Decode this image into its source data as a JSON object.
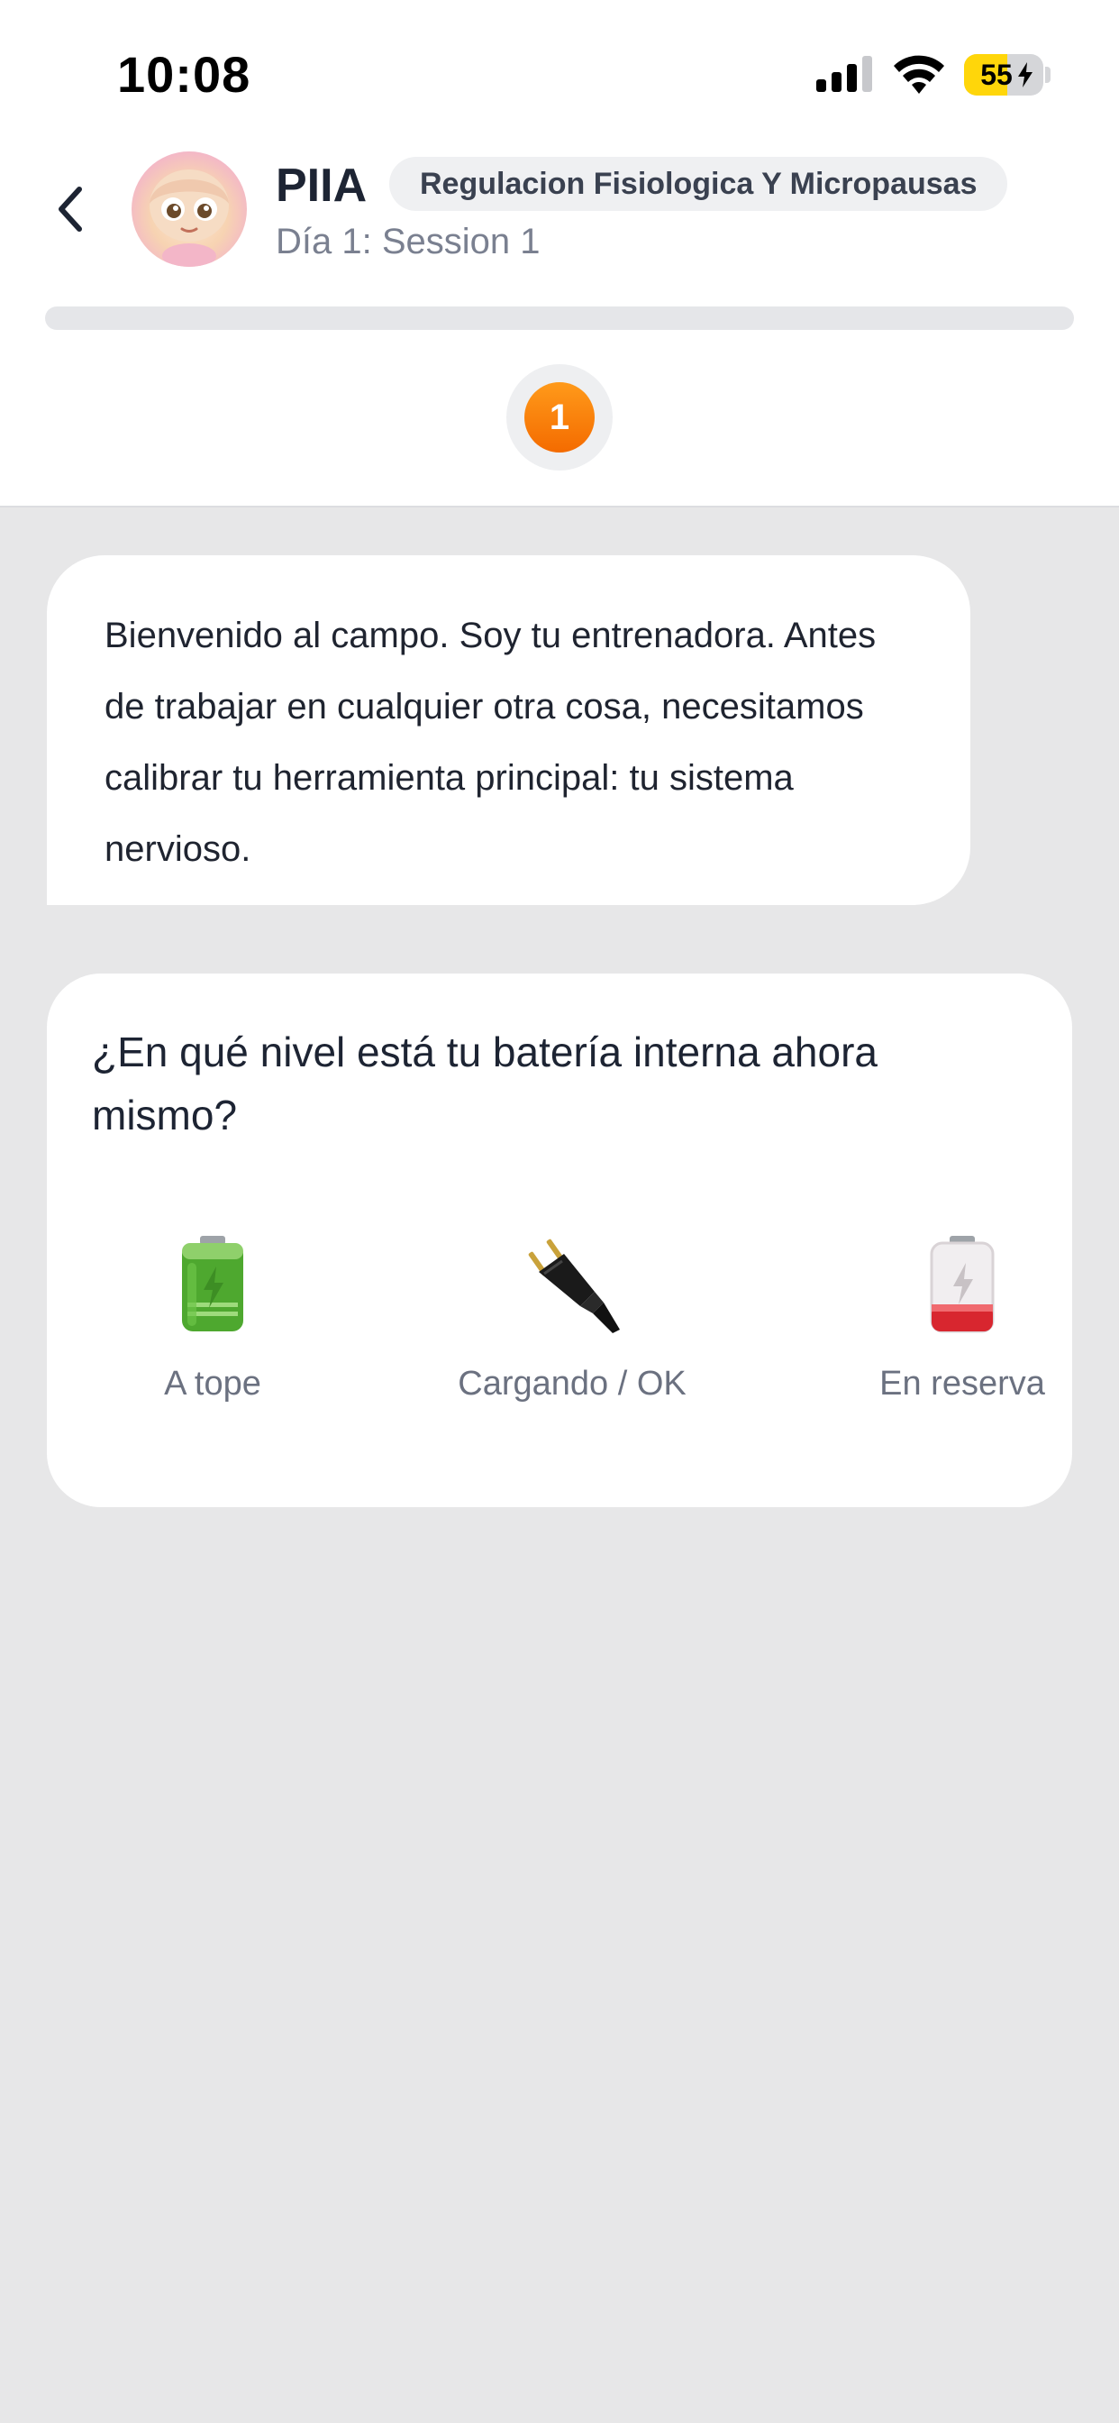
{
  "status_bar": {
    "time": "10:08",
    "battery_level": "55"
  },
  "header": {
    "name": "PIIA",
    "chip": "Regulacion Fisiologica Y Micropausas",
    "subtitle": "Día 1: Session 1",
    "progress": 0,
    "step_number": "1",
    "accent_color": "#f47d0a"
  },
  "chat": {
    "message": "Bienvenido al campo. Soy tu entrenadora. Antes de trabajar en cualquier otra cosa, necesitamos calibrar tu herramienta principal: tu sistema nervioso."
  },
  "question": {
    "text": "¿En qué nivel está tu batería interna ahora mismo?",
    "options": [
      {
        "label": "A tope",
        "icon": "full-battery-icon"
      },
      {
        "label": "Cargando / OK",
        "icon": "plug-icon"
      },
      {
        "label": "En reserva",
        "icon": "low-battery-icon"
      }
    ]
  }
}
